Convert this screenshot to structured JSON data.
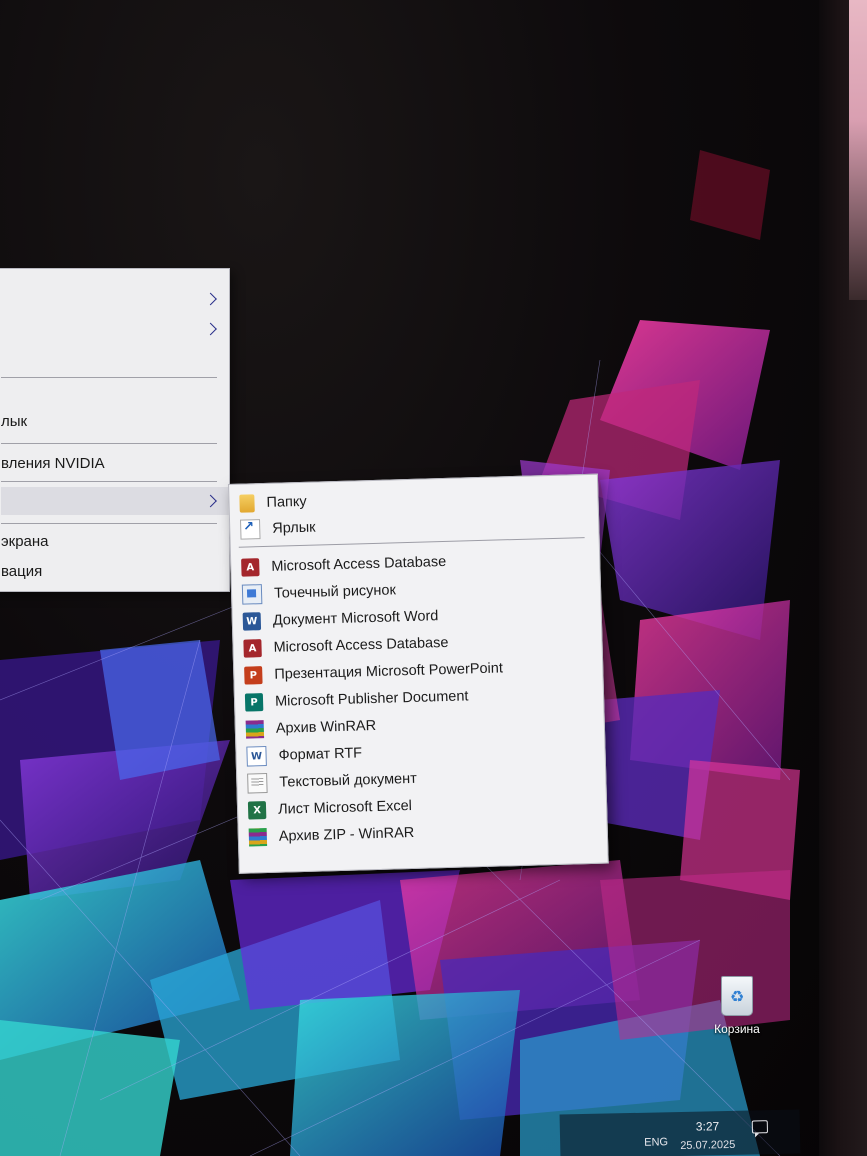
{
  "main_menu": {
    "items": [
      {
        "label": "",
        "has_submenu": true
      },
      {
        "label": "",
        "has_submenu": true
      },
      {
        "label": "лык",
        "has_submenu": false
      },
      {
        "label": "вления NVIDIA",
        "has_submenu": false
      },
      {
        "label": "",
        "has_submenu": true
      },
      {
        "label": " экрана",
        "has_submenu": false
      },
      {
        "label": "вация",
        "has_submenu": false
      }
    ]
  },
  "submenu": {
    "items": [
      {
        "label": "Папку",
        "icon": "folder-icon"
      },
      {
        "label": "Ярлык",
        "icon": "shortcut-icon"
      },
      {
        "label": "Microsoft Access Database",
        "icon": "access-icon"
      },
      {
        "label": "Точечный рисунок",
        "icon": "bitmap-icon"
      },
      {
        "label": "Документ Microsoft Word",
        "icon": "word-icon"
      },
      {
        "label": "Microsoft Access Database",
        "icon": "access-icon"
      },
      {
        "label": "Презентация Microsoft PowerPoint",
        "icon": "powerpoint-icon"
      },
      {
        "label": "Microsoft Publisher Document",
        "icon": "publisher-icon"
      },
      {
        "label": "Архив WinRAR",
        "icon": "winrar-icon"
      },
      {
        "label": "Формат RTF",
        "icon": "rtf-icon"
      },
      {
        "label": "Текстовый документ",
        "icon": "text-document-icon"
      },
      {
        "label": "Лист Microsoft Excel",
        "icon": "excel-icon"
      },
      {
        "label": "Архив ZIP - WinRAR",
        "icon": "zip-icon"
      }
    ]
  },
  "desktop": {
    "recycle_bin_label": "Корзина"
  },
  "taskbar": {
    "language": "ENG",
    "time": "3:27",
    "date": "25.07.2025"
  },
  "icon_glyphs": {
    "access": "A",
    "word": "W",
    "powerpoint": "P",
    "publisher": "P",
    "rtf": "W",
    "excel": "X"
  },
  "colors": {
    "menu_bg": "#eeeef0",
    "chevron": "#2a2f8a",
    "accent_magenta": "#e0369a",
    "accent_cyan": "#3ad0d8"
  }
}
